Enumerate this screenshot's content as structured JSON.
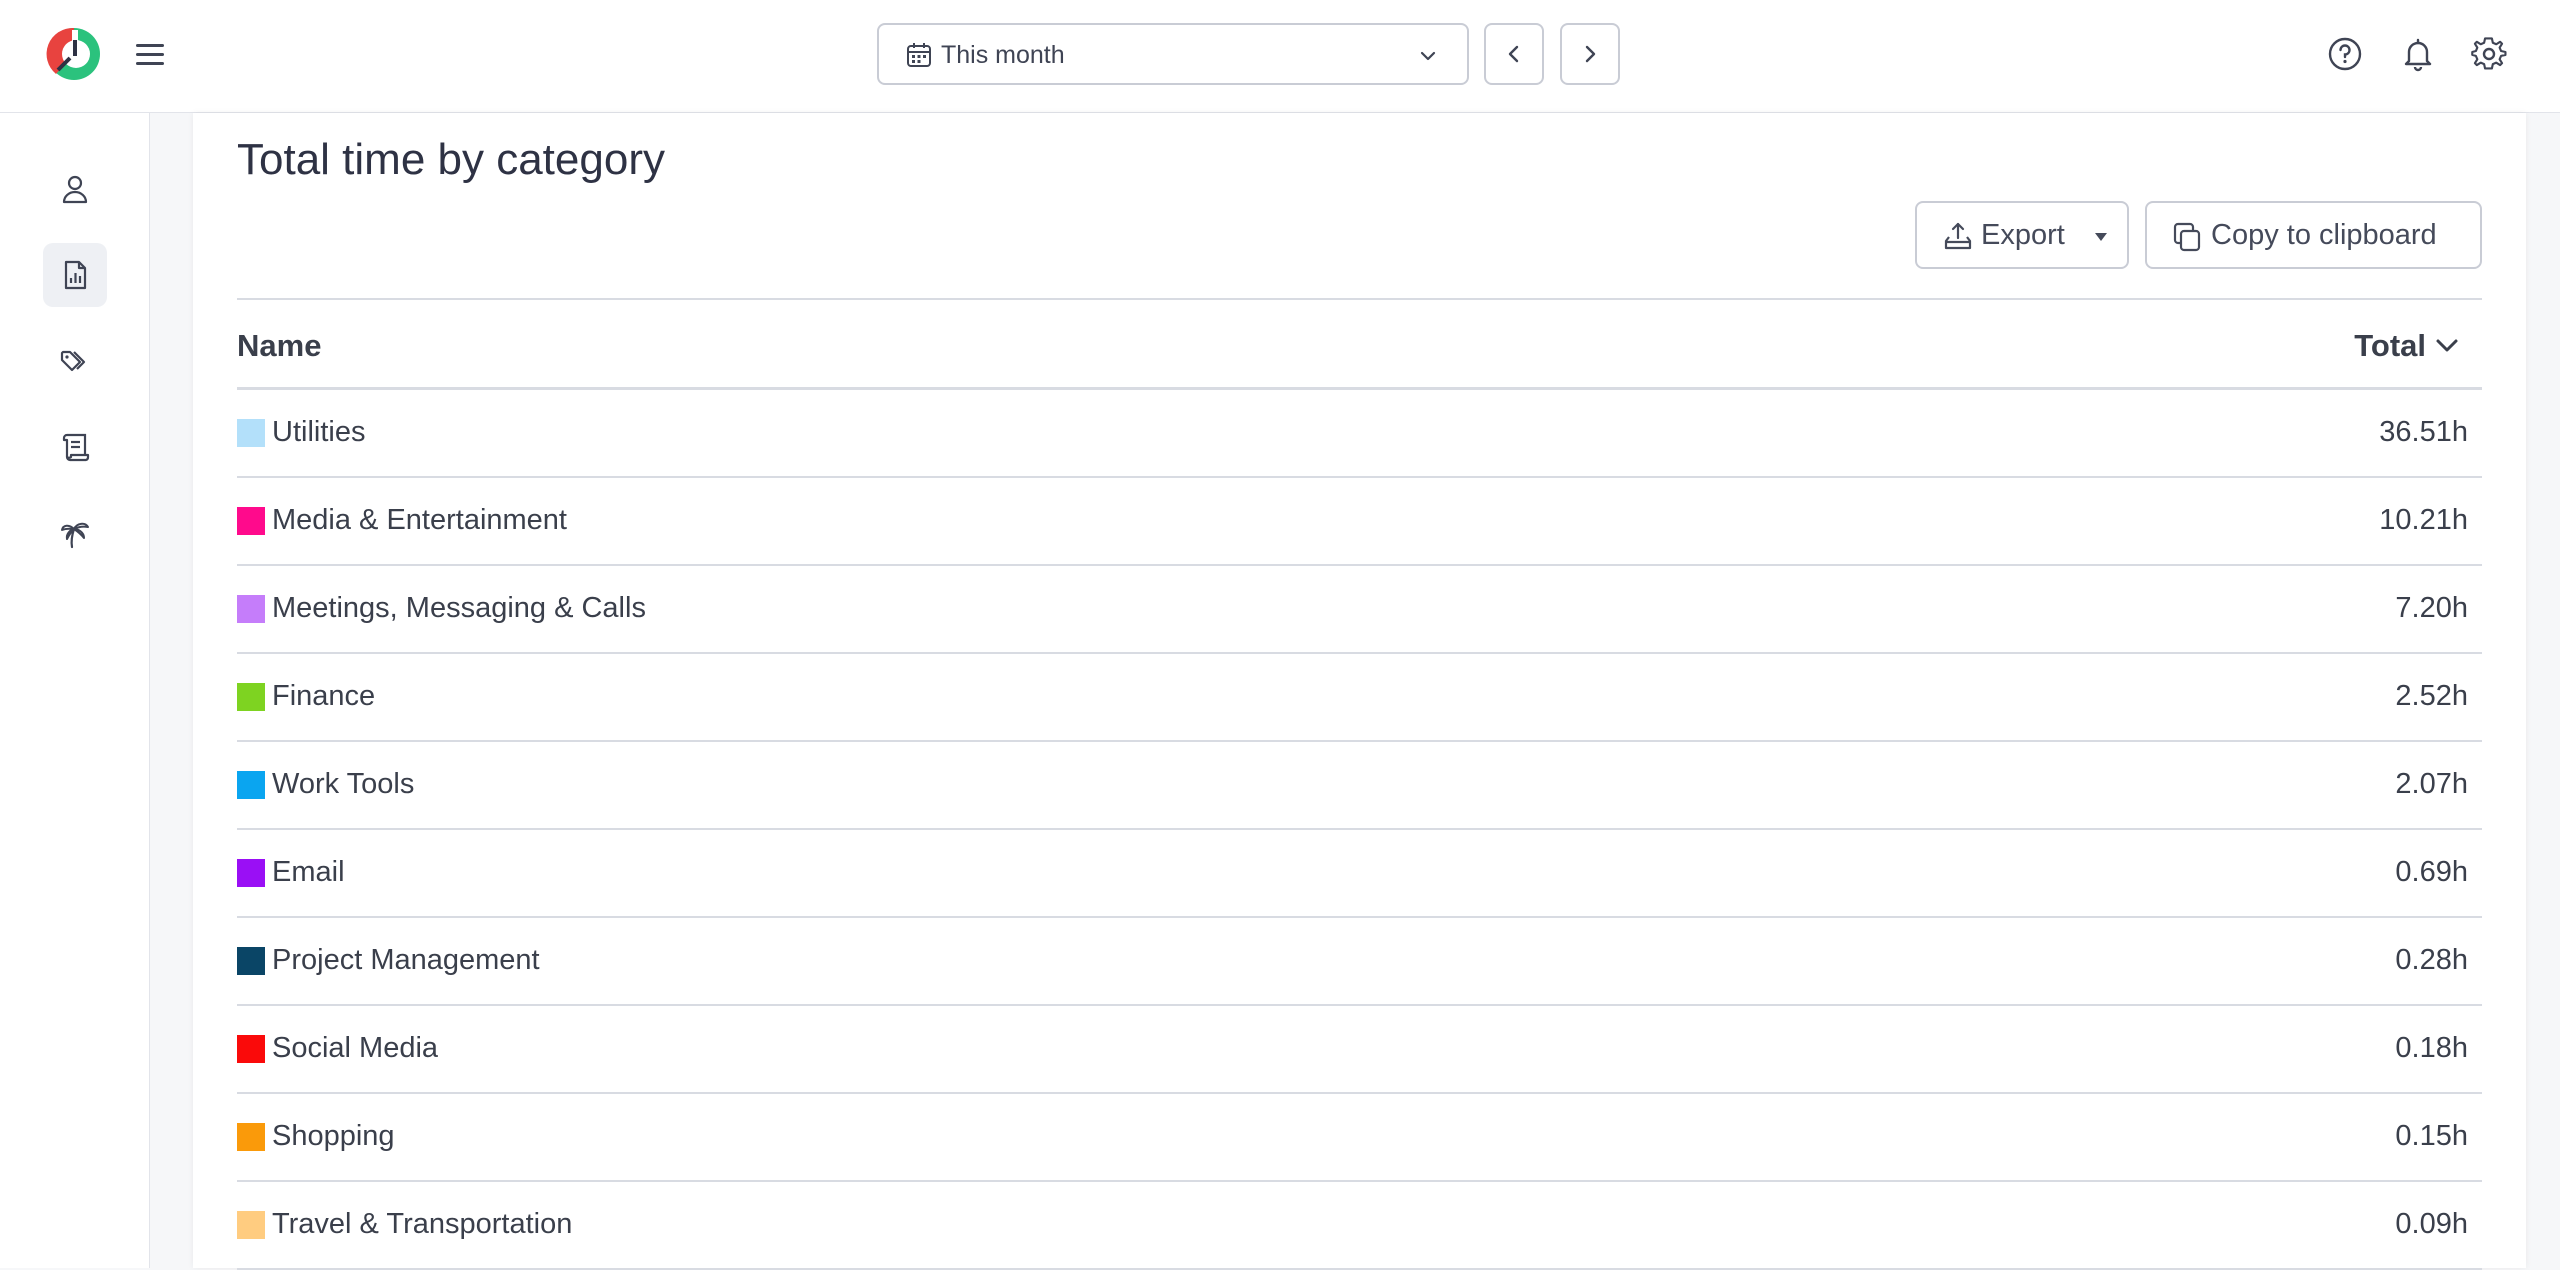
{
  "header": {
    "date_range": "This month"
  },
  "page": {
    "title": "Total time by category",
    "export_label": "Export",
    "copy_label": "Copy to clipboard"
  },
  "table": {
    "col_name": "Name",
    "col_total": "Total",
    "rows": [
      {
        "name": "Utilities",
        "total": "36.51h",
        "color": "#b3e0fa"
      },
      {
        "name": "Media & Entertainment",
        "total": "10.21h",
        "color": "#ff0a8c"
      },
      {
        "name": "Meetings, Messaging & Calls",
        "total": "7.20h",
        "color": "#c57dfa"
      },
      {
        "name": "Finance",
        "total": "2.52h",
        "color": "#7ed321"
      },
      {
        "name": "Work Tools",
        "total": "2.07h",
        "color": "#0aa5f0"
      },
      {
        "name": "Email",
        "total": "0.69h",
        "color": "#9a0ff5"
      },
      {
        "name": "Project Management",
        "total": "0.28h",
        "color": "#0a4566"
      },
      {
        "name": "Social Media",
        "total": "0.18h",
        "color": "#fa0a0a"
      },
      {
        "name": "Shopping",
        "total": "0.15h",
        "color": "#fa9a0a"
      },
      {
        "name": "Travel & Transportation",
        "total": "0.09h",
        "color": "#ffcc80"
      }
    ]
  },
  "icons": {
    "logo": "logo-icon",
    "menu": "hamburger-menu-icon",
    "help": "help-circle-icon",
    "notifications": "bell-icon",
    "settings": "gear-icon",
    "sidebar": [
      "user-icon",
      "report-icon",
      "tags-icon",
      "scroll-icon",
      "palm-tree-icon"
    ]
  },
  "colors": {
    "brand_red": "#e8433f",
    "brand_green": "#2bc27d",
    "active_bg": "#eef0f4"
  }
}
